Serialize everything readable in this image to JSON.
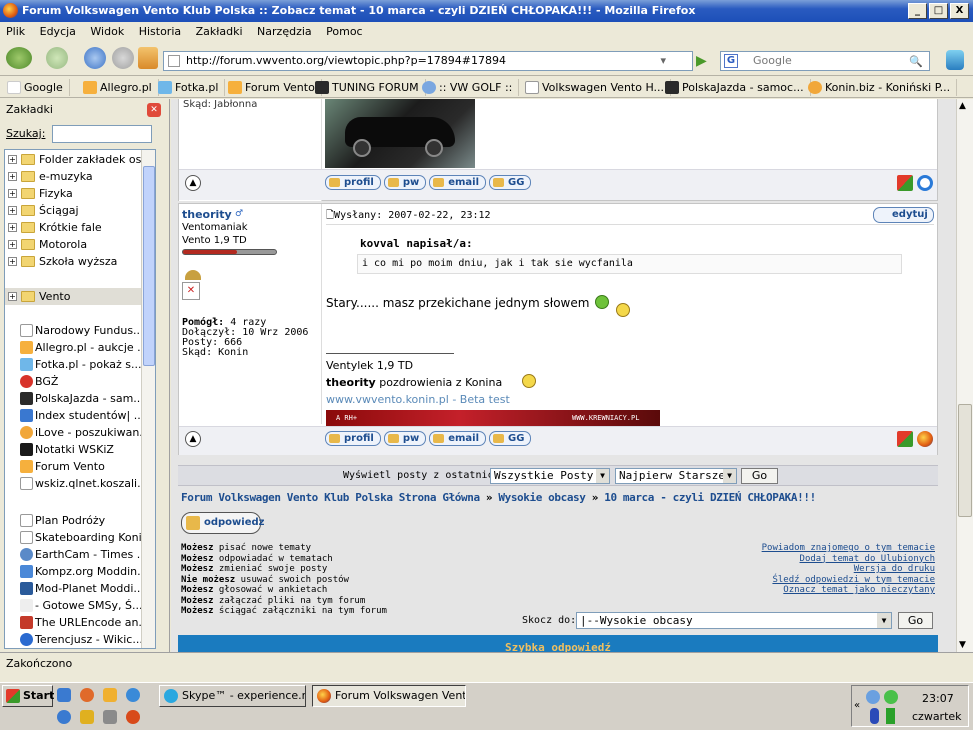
{
  "window": {
    "title": "Forum Volkswagen Vento Klub Polska :: Zobacz temat - 10 marca - czyli DZIEŃ CHŁOPAKA!!! - Mozilla Firefox",
    "minimize": "_",
    "maximize": "□",
    "close": "X"
  },
  "menu": [
    "Plik",
    "Edycja",
    "Widok",
    "Historia",
    "Zakładki",
    "Narzędzia",
    "Pomoc"
  ],
  "nav": {
    "url": "http://forum.vwvento.org/viewtopic.php?p=17894#17894",
    "search_placeholder": "Google"
  },
  "bookmarks": [
    "Google",
    "Allegro.pl",
    "Fotka.pl",
    "Forum Vento",
    "TUNING FORUM",
    ":: VW GOLF ::",
    "Volkswagen Vento H...",
    "PolskaJazda - samoc...",
    "Konin.biz - Koniński P..."
  ],
  "sidebar": {
    "title": "Zakładki",
    "search_label": "Szukaj:",
    "folders": [
      "Folder zakładek os...",
      "e-muzyka",
      "Fizyka",
      "Ściągaj",
      "Krótkie fale",
      "Motorola",
      "Szkoła wyższa",
      "Vento"
    ],
    "items": [
      "Narodowy Fundus...",
      "Allegro.pl - aukcje ...",
      "Fotka.pl - pokaż s...",
      "BGŻ",
      "PolskaJazda - sam...",
      "Index studentów| ...",
      "iLove - poszukiwan...",
      "Notatki WSKiZ",
      "Forum Vento",
      "wskiz.qlnet.koszali...",
      "Plan Podróży",
      "Skateboarding Konin",
      "EarthCam - Times ...",
      "Kompz.org Moddin...",
      "Mod-Planet  Moddi...",
      "- Gotowe SMSy, Ś...",
      "The URLEncode an...",
      "Terencjusz - Wikic..."
    ]
  },
  "prev_post": {
    "location": "Skąd: Jabłonna",
    "buttons": [
      "profil",
      "pw",
      "email",
      "GG"
    ]
  },
  "post": {
    "author": "theority",
    "rank": "Ventomaniak",
    "car": "Vento 1,9 TD",
    "helped_label": "Pomógł:",
    "helped": "4 razy",
    "joined": "Dołączył: 10 Wrz 2006",
    "posts": "Posty: 666",
    "location": "Skąd: Konin",
    "posted": "Wysłany: 2007-02-22, 23:12",
    "edit": "edytuj",
    "quote_author": "kovval napisał/a:",
    "quote_text": "i co mi po moim dniu, jak i tak sie wycfanila",
    "body": "Stary...... masz przekichane jednym słowem",
    "sig_car": "Ventylek 1,9 TD",
    "sig_name": "theority",
    "sig_text": " pozdrowienia z Konina",
    "sig_link": "www.vwvento.konin.pl - Beta test",
    "banner_left": "A RH+",
    "banner_right": "WWW.KREWNIACY.PL",
    "buttons": [
      "profil",
      "pw",
      "email",
      "GG"
    ]
  },
  "filter": {
    "label": "Wyświetl posty z ostatnich:",
    "period": "Wszystkie Posty",
    "order": "Najpierw Starsze",
    "go": "Go"
  },
  "breadcrumb": {
    "home": "Forum Volkswagen Vento Klub Polska Strona Główna",
    "sep": "»",
    "forum": "Wysokie obcasy",
    "topic": "10 marca - czyli DZIEŃ CHŁOPAKA!!!"
  },
  "reply_button": "odpowiedz",
  "permissions": [
    {
      "b": "Możesz",
      "t": " pisać nowe tematy"
    },
    {
      "b": "Możesz",
      "t": " odpowiadać w tematach"
    },
    {
      "b": "Możesz",
      "t": " zmieniać swoje posty"
    },
    {
      "b": "Nie możesz",
      "t": " usuwać swoich postów"
    },
    {
      "b": "Możesz",
      "t": " głosować w ankietach"
    },
    {
      "b": "Możesz",
      "t": " załączać pliki na tym forum"
    },
    {
      "b": "Możesz",
      "t": " ściągać załączniki na tym forum"
    }
  ],
  "topic_links": [
    "Powiadom znajomego o tym temacie",
    "Dodaj temat do Ulubionych",
    "Wersja do druku",
    "Śledź odpowiedzi w tym temacie",
    "Oznacz temat jako nieczytany"
  ],
  "jump": {
    "label": "Skocz do:",
    "value": "|--Wysokie obcasy",
    "go": "Go"
  },
  "quick_reply": "Szybka odpowiedź",
  "status": "Zakończono",
  "taskbar": {
    "start": "Start",
    "tasks": [
      "Skype™ - experience.net",
      "Forum Volkswagen Vento..."
    ],
    "time": "23:07",
    "day": "czwartek"
  }
}
